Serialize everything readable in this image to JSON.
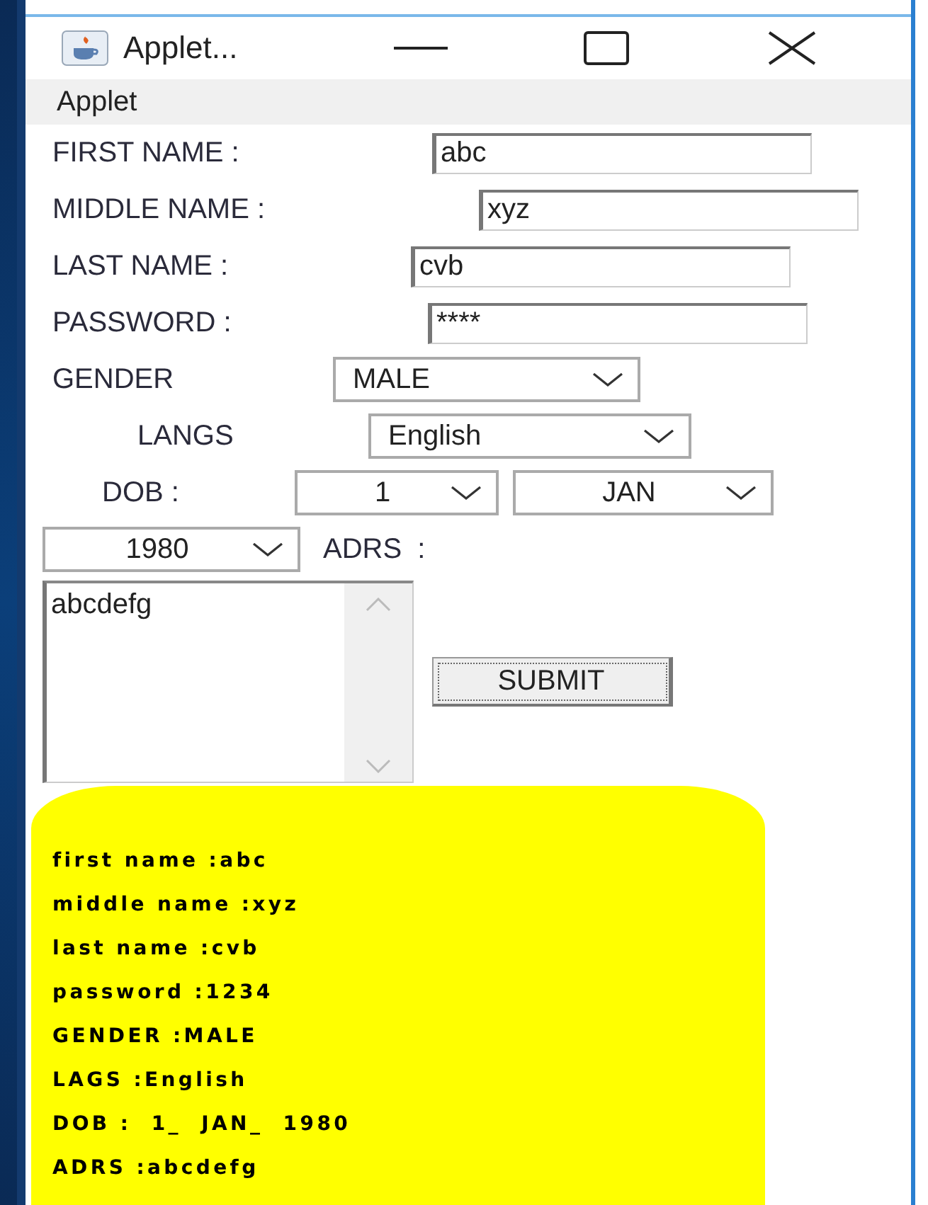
{
  "window": {
    "title": "Applet..."
  },
  "menu": [
    "Applet"
  ],
  "text_fields": [
    {
      "label": "FIRST NAME :",
      "value": "abc"
    },
    {
      "label": "MIDDLE NAME :",
      "value": "xyz"
    },
    {
      "label": "LAST NAME :",
      "value": "cvb"
    },
    {
      "label": "PASSWORD :",
      "value": "****"
    }
  ],
  "gender": {
    "label": "GENDER",
    "value": "MALE"
  },
  "langs": {
    "label": "LANGS",
    "value": "English"
  },
  "dob": {
    "label": "DOB :",
    "day": "1",
    "month": "JAN",
    "year": "1980"
  },
  "address": {
    "label": "ADRS  :",
    "value": "abcdefg"
  },
  "submit_button": "SUBMIT",
  "output_lines": [
    "first name :abc",
    "middle name :xyz",
    "last name :cvb",
    "password :1234",
    "GENDER :MALE",
    "LAGS :English",
    "DOB :  1_  JAN_  1980",
    "ADRS :abcdefg"
  ]
}
